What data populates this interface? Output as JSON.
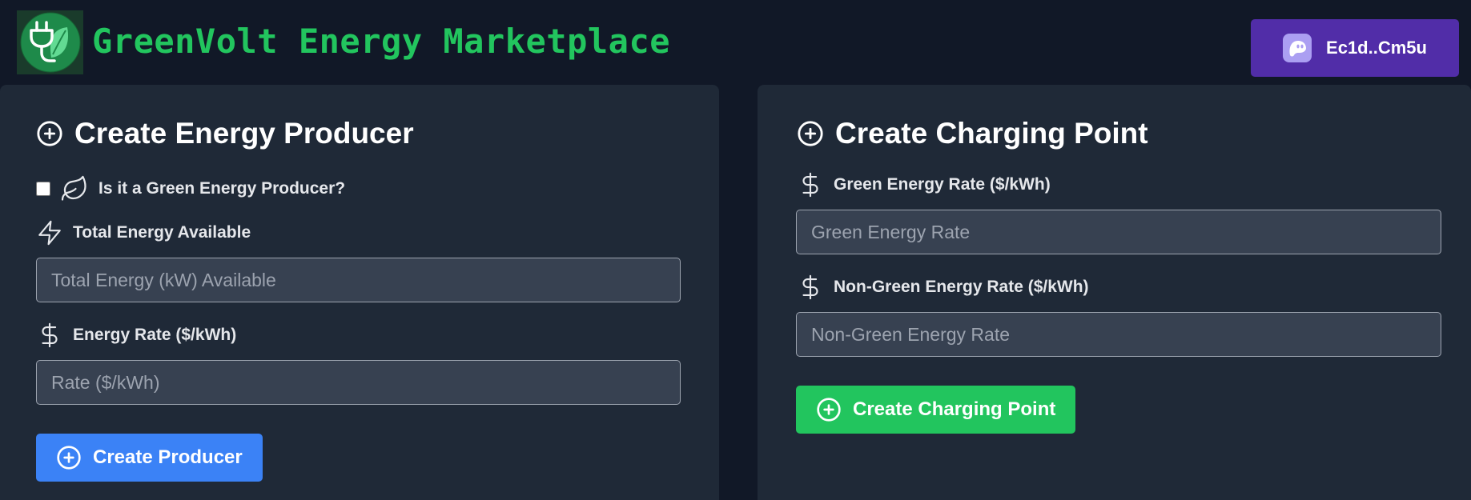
{
  "header": {
    "app_title": "GreenVolt Energy Marketplace",
    "wallet_label": "Ec1d..Cm5u",
    "colors": {
      "title": "#22c55e",
      "wallet_button": "#512da8",
      "background": "#111827"
    },
    "logo_icon": "plug-leaf-logo"
  },
  "producer_form": {
    "title": "Create Energy Producer",
    "green_checkbox": {
      "label": "Is it a Green Energy Producer?",
      "checked": false,
      "icon": "leaf-icon"
    },
    "total_energy": {
      "label": "Total Energy Available",
      "placeholder": "Total Energy (kW) Available",
      "value": "",
      "icon": "zap-icon"
    },
    "energy_rate": {
      "label": "Energy Rate ($/kWh)",
      "placeholder": "Rate ($/kWh)",
      "value": "",
      "icon": "dollar-icon"
    },
    "submit_label": "Create Producer",
    "submit_color": "#3b82f6"
  },
  "charging_form": {
    "title": "Create Charging Point",
    "green_rate": {
      "label": "Green Energy Rate ($/kWh)",
      "placeholder": "Green Energy Rate",
      "value": "",
      "icon": "dollar-icon"
    },
    "non_green_rate": {
      "label": "Non-Green Energy Rate ($/kWh)",
      "placeholder": "Non-Green Energy Rate",
      "value": "",
      "icon": "dollar-icon"
    },
    "submit_label": "Create Charging Point",
    "submit_color": "#22c55e"
  }
}
